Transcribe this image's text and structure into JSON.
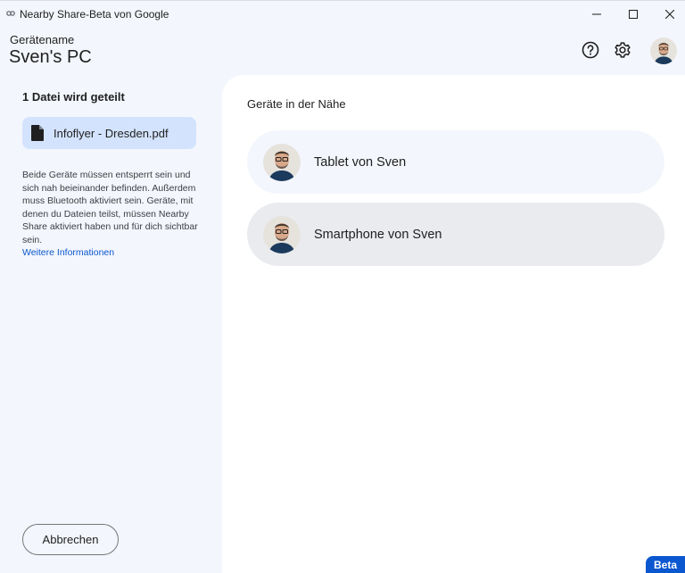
{
  "window": {
    "title": "Nearby Share-Beta von Google",
    "icon": "nearby-share-icon",
    "controls": [
      "minimize-icon",
      "maximize-icon",
      "close-icon"
    ]
  },
  "header": {
    "device_label": "Gerätename",
    "device_name": "Sven's PC",
    "icons": [
      "help-icon",
      "gear-icon"
    ],
    "avatar": "avatar"
  },
  "sidebar": {
    "share_count": "1 Datei wird geteilt",
    "file": {
      "name": "Infoflyer - Dresden.pdf",
      "icon": "file-icon"
    },
    "info_text": "Beide Geräte müssen entsperrt sein und sich nah beieinander befinden. Außerdem muss Bluetooth aktiviert sein. Geräte, mit denen du Dateien teilst, müssen Nearby Share aktiviert haben und für dich sichtbar sein.",
    "info_link": "Weitere Informationen",
    "cancel_label": "Abbrechen"
  },
  "main": {
    "title": "Geräte in der Nähe",
    "devices": [
      {
        "label": "Tablet von Sven",
        "selected": false
      },
      {
        "label": "Smartphone von Sven",
        "selected": true
      }
    ]
  },
  "badge": {
    "label": "Beta"
  },
  "colors": {
    "background": "#f3f6fc",
    "file_chip": "#d3e3fd",
    "accent": "#0b57d0",
    "card": "#f3f6fc",
    "card_selected": "#e9ebef"
  }
}
